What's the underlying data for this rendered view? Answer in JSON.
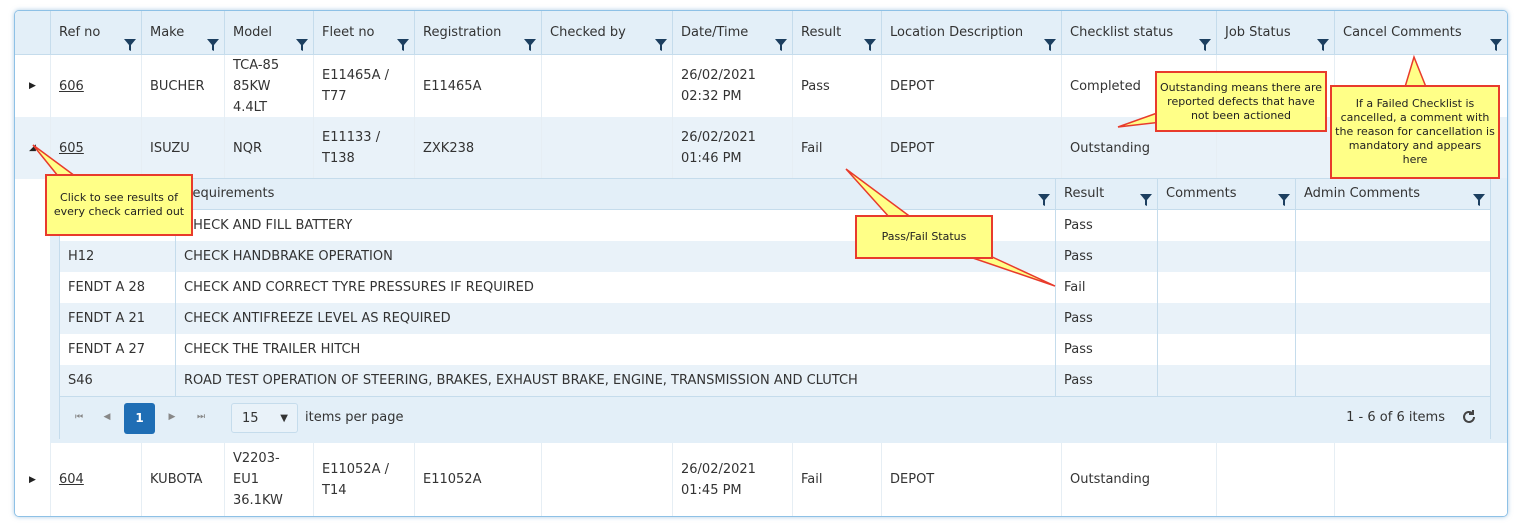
{
  "columns": [
    {
      "key": "ref",
      "label": "Ref no"
    },
    {
      "key": "make",
      "label": "Make"
    },
    {
      "key": "model",
      "label": "Model"
    },
    {
      "key": "fleet",
      "label": "Fleet no"
    },
    {
      "key": "reg",
      "label": "Registration"
    },
    {
      "key": "checked",
      "label": "Checked by"
    },
    {
      "key": "dt",
      "label": "Date/Time"
    },
    {
      "key": "result",
      "label": "Result"
    },
    {
      "key": "loc",
      "label": "Location Description"
    },
    {
      "key": "cstatus",
      "label": "Checklist status"
    },
    {
      "key": "jstatus",
      "label": "Job Status"
    },
    {
      "key": "cancel",
      "label": "Cancel Comments"
    }
  ],
  "rows": [
    {
      "ref": "606",
      "make": "BUCHER",
      "model": "TCA-85 85KW 4.4LT",
      "fleet": "E11465A / T77",
      "reg": "E11465A",
      "checked": "",
      "date": "26/02/2021",
      "time": "02:32 PM",
      "result": "Pass",
      "loc": "DEPOT",
      "cstatus": "Completed",
      "jstatus": "",
      "cancel": "",
      "expanded": false
    },
    {
      "ref": "605",
      "make": "ISUZU",
      "model": "NQR",
      "fleet": "E11133 / T138",
      "reg": "ZXK238",
      "checked": "",
      "date": "26/02/2021",
      "time": "01:46 PM",
      "result": "Fail",
      "loc": "DEPOT",
      "cstatus": "Outstanding",
      "jstatus": "",
      "cancel": "",
      "expanded": true
    },
    {
      "ref": "604",
      "make": "KUBOTA",
      "model": "V2203-EU1 36.1KW",
      "fleet": "E11052A / T14",
      "reg": "E11052A",
      "checked": "",
      "date": "26/02/2021",
      "time": "01:45 PM",
      "result": "Fail",
      "loc": "DEPOT",
      "cstatus": "Outstanding",
      "jstatus": "",
      "cancel": "",
      "expanded": false
    }
  ],
  "detail": {
    "columns": [
      {
        "key": "code",
        "label": ""
      },
      {
        "key": "req",
        "label": "Requirements"
      },
      {
        "key": "result",
        "label": "Result"
      },
      {
        "key": "comments",
        "label": "Comments"
      },
      {
        "key": "admin",
        "label": "Admin Comments"
      }
    ],
    "rows": [
      {
        "code": "",
        "req": "CHECK AND FILL BATTERY",
        "result": "Pass",
        "comments": "",
        "admin": ""
      },
      {
        "code": "H12",
        "req": "CHECK HANDBRAKE OPERATION",
        "result": "Pass",
        "comments": "",
        "admin": ""
      },
      {
        "code": "FENDT A 28",
        "req": "CHECK AND CORRECT TYRE PRESSURES IF REQUIRED",
        "result": "Fail",
        "comments": "",
        "admin": ""
      },
      {
        "code": "FENDT A 21",
        "req": "CHECK ANTIFREEZE LEVEL AS REQUIRED",
        "result": "Pass",
        "comments": "",
        "admin": ""
      },
      {
        "code": "FENDT A 27",
        "req": "CHECK THE TRAILER HITCH",
        "result": "Pass",
        "comments": "",
        "admin": ""
      },
      {
        "code": "S46",
        "req": "ROAD TEST OPERATION OF STEERING, BRAKES, EXHAUST BRAKE, ENGINE, TRANSMISSION AND CLUTCH",
        "result": "Pass",
        "comments": "",
        "admin": ""
      }
    ],
    "pager": {
      "current_page": "1",
      "page_size": "15",
      "items_per_page_label": "items per page",
      "summary": "1 - 6 of 6 items"
    }
  },
  "callouts": {
    "expand": "Click to see results of every check carried out",
    "outstanding": "Outstanding means there are reported defects that have not been actioned",
    "cancel": "If a Failed Checklist is cancelled, a comment with the reason for cancellation is mandatory and appears here",
    "passfail": "Pass/Fail Status"
  },
  "colors": {
    "header_bg": "#e3eff8",
    "accent": "#1f6eb5",
    "callout_bg": "#ffff87",
    "callout_border": "#e83b2c"
  }
}
